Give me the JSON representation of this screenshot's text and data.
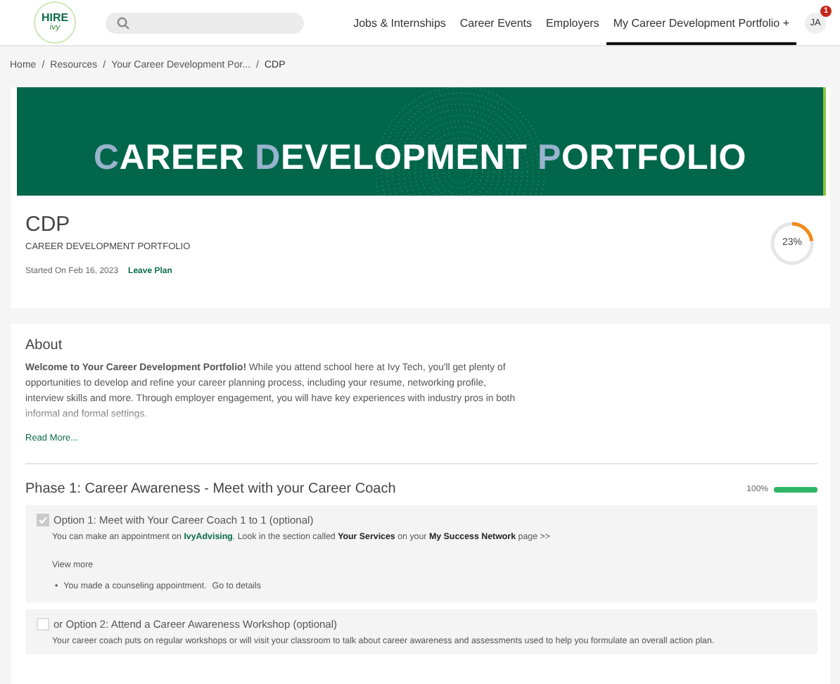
{
  "header": {
    "logo": {
      "title": "HIRE",
      "subtitle": "ivy"
    },
    "nav": [
      {
        "label": "Jobs & Internships",
        "selected": false
      },
      {
        "label": "Career Events",
        "selected": false
      },
      {
        "label": "Employers",
        "selected": false
      },
      {
        "label": "My Career Development Portfolio +",
        "selected": true
      }
    ],
    "avatar": {
      "initials": "JA",
      "badge": "1"
    }
  },
  "breadcrumbs": {
    "separator": "/",
    "items": [
      "Home",
      "Resources",
      "Your Career Development Por...",
      "CDP"
    ]
  },
  "banner": {
    "title": "CAREER DEVELOPMENT PORTFOLIO"
  },
  "plan": {
    "title": "CDP",
    "subtitle": "CAREER DEVELOPMENT PORTFOLIO",
    "started": "Started On Feb 16, 2023",
    "action": "Leave Plan",
    "progress": {
      "level": 0.23,
      "reading": "23%"
    }
  },
  "about": {
    "heading": "About",
    "text": "**Welcome to Your Career Development Portfolio!** While you attend school here at Ivy Tech, you'll get plenty of opportunities to develop and refine your career planning process, including your resume, networking profile, interview skills and more. Through employer engagement, you will have key experiences with industry pros in both informal and formal settings.",
    "read_more": "Read More..."
  },
  "phases": [
    {
      "title": "Phase 1: Career Awareness - Meet with your Career Coach",
      "progress": {
        "level": 1,
        "reading": "100%"
      },
      "options": [
        {
          "title": "Option 1: Meet with Your Career Coach 1 to 1 (optional)",
          "checked": true,
          "description": [
            {
              "kind": "text",
              "text": "You can make an appointment on "
            },
            {
              "kind": "link",
              "text": "IvyAdvising"
            },
            {
              "kind": "text",
              "text": ". Look in the section called **Your Services** on your **My Success Network** page >>"
            }
          ],
          "view_more": "View more",
          "bullets": [
            {
              "marker": "•",
              "text": "You made a counseling appointment.",
              "link": "Go to details"
            }
          ]
        },
        {
          "title": "or Option 2: Attend a Career Awareness Workshop (optional)",
          "checked": false,
          "description": [
            {
              "kind": "text",
              "text": "Your career coach puts on regular workshops or will visit your classroom to talk about career awareness and assessments used to help you formulate an overall action plan."
            }
          ]
        }
      ]
    }
  ]
}
